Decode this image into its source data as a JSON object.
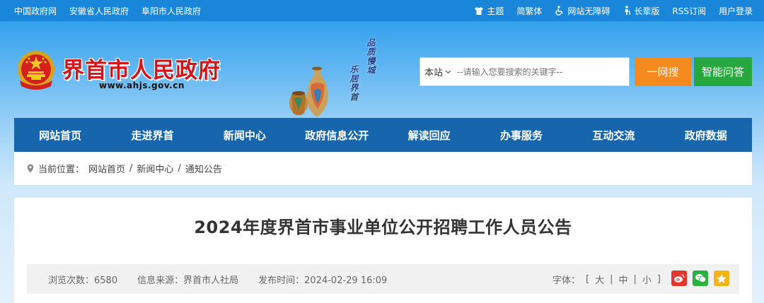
{
  "topbar": {
    "links": [
      "中国政府网",
      "安徽省人民政府",
      "阜阳市人民政府"
    ],
    "tools": [
      {
        "label": "主题",
        "icon": "shirt-icon"
      },
      {
        "label": "简繁体",
        "icon": ""
      },
      {
        "label": "网站无障碍",
        "icon": "wheelchair-icon"
      },
      {
        "label": "长辈版",
        "icon": "elder-icon"
      },
      {
        "label": "RSS订阅",
        "icon": ""
      },
      {
        "label": "用户登录",
        "icon": ""
      }
    ]
  },
  "header": {
    "site_title": "界首市人民政府",
    "site_url": "www.ahjs.gov.cn",
    "slogan_right": "品质慢城",
    "slogan_left": "乐居界首"
  },
  "search": {
    "scope": "本站",
    "placeholder": "--请输入您要搜索的关键字--",
    "search_button": "一网搜",
    "ask_button": "智能问答"
  },
  "nav": [
    "网站首页",
    "走进界首",
    "新闻中心",
    "政府信息公开",
    "解读回应",
    "办事服务",
    "互动交流",
    "政府数据"
  ],
  "breadcrumb": {
    "prefix": "当前位置：",
    "items": [
      "网站首页",
      "新闻中心",
      "通知公告"
    ],
    "separator": "/"
  },
  "article": {
    "title": "2024年度界首市事业单位公开招聘工作人员公告",
    "views_label": "浏览次数：",
    "views": "6580",
    "source_label": "信息来源：",
    "source": "界首市人社局",
    "date_label": "发布时间：",
    "date": "2024-02-29 16:09",
    "font_label": "字体：",
    "font_sizes": [
      "大",
      "中",
      "小"
    ],
    "share_icons": [
      "weibo-icon",
      "wechat-icon",
      "qzone-icon"
    ]
  },
  "colors": {
    "topbar": "#1a86da",
    "nav": "#1766ad",
    "title_red": "#d4141a",
    "search_orange": "#f58a1f",
    "ask_green": "#27a83e"
  }
}
